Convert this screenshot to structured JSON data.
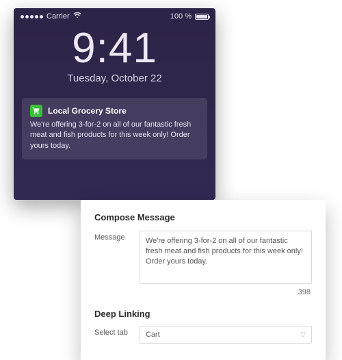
{
  "phone": {
    "carrier": "Carrier",
    "battery_pct": "100 %",
    "time": "9:41",
    "date": "Tuesday, October 22",
    "notification": {
      "app_name": "Local Grocery Store",
      "body": "We're offering 3-for-2 on all of our fantastic fresh meat and fish products for this week only! Order yours today."
    }
  },
  "panel": {
    "compose_heading": "Compose Message",
    "message_label": "Message",
    "message_value": "We're offering 3-for-2 on all of our fantastic fresh meat and fish products for this week only! Order yours today.",
    "char_counter": "398",
    "deep_heading": "Deep Linking",
    "select_label": "Select tab",
    "select_value": "Cart"
  }
}
